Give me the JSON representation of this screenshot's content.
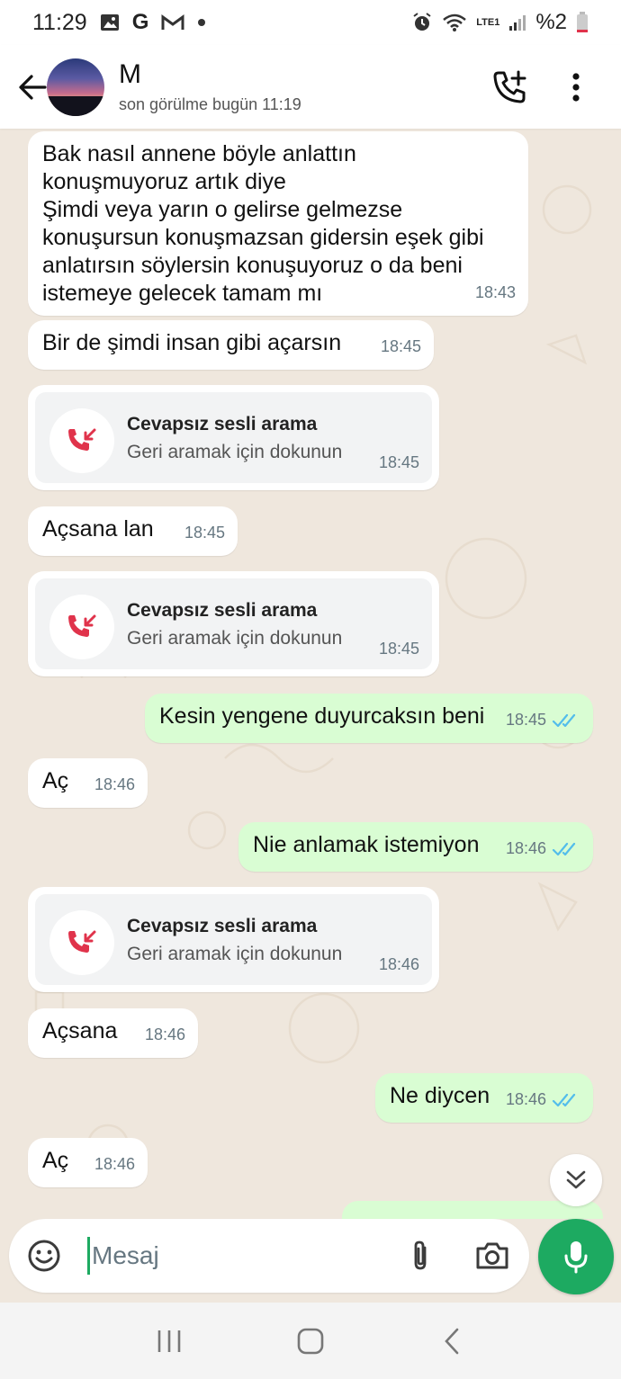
{
  "status_bar": {
    "time": "11:29",
    "battery": "%2",
    "network": "LTE1",
    "icons": [
      "gallery-icon",
      "google-icon",
      "gmail-icon",
      "dot-icon",
      "alarm-icon",
      "wifi-icon",
      "signal-icon",
      "battery-icon"
    ]
  },
  "header": {
    "name": "M",
    "last_seen": "son görülme bugün 11:19",
    "icons": [
      "back-arrow-icon",
      "add-call-icon",
      "more-vert-icon"
    ]
  },
  "messages": [
    {
      "type": "in",
      "text": "Bak nasıl annene böyle anlattın\nkonuşmuyoruz artık diye\nŞimdi veya yarın o gelirse gelmezse\nkonuşursun konuşmazsan gidersin eşek gibi\nanlatırsın söylersin konuşuyoruz o da beni\nistemeye gelecek tamam mı",
      "time": "18:43"
    },
    {
      "type": "in",
      "text": "Bir de şimdi insan gibi açarsın",
      "time": "18:45"
    },
    {
      "type": "call",
      "title": "Cevapsız sesli arama",
      "subtitle": "Geri aramak için dokunun",
      "time": "18:45"
    },
    {
      "type": "in",
      "text": "Açsana lan",
      "time": "18:45"
    },
    {
      "type": "call",
      "title": "Cevapsız sesli arama",
      "subtitle": "Geri aramak için dokunun",
      "time": "18:45"
    },
    {
      "type": "out",
      "text": "Kesin yengene duyurcaksın beni",
      "time": "18:45"
    },
    {
      "type": "in",
      "text": "Aç",
      "time": "18:46"
    },
    {
      "type": "out",
      "text": "Nie anlamak istemiyon",
      "time": "18:46"
    },
    {
      "type": "call",
      "title": "Cevapsız sesli arama",
      "subtitle": "Geri aramak için dokunun",
      "time": "18:46"
    },
    {
      "type": "in",
      "text": "Açsana",
      "time": "18:46"
    },
    {
      "type": "out",
      "text": "Ne diycen",
      "time": "18:46"
    },
    {
      "type": "in",
      "text": "Aç",
      "time": "18:46"
    }
  ],
  "input": {
    "placeholder": "Mesaj",
    "value": ""
  },
  "colors": {
    "chat_bg": "#efe7dd",
    "outgoing_bubble": "#d9fdd3",
    "incoming_bubble": "#ffffff",
    "accent": "#1daa61",
    "read_ticks": "#53bdeb",
    "missed_call": "#e0334b"
  }
}
